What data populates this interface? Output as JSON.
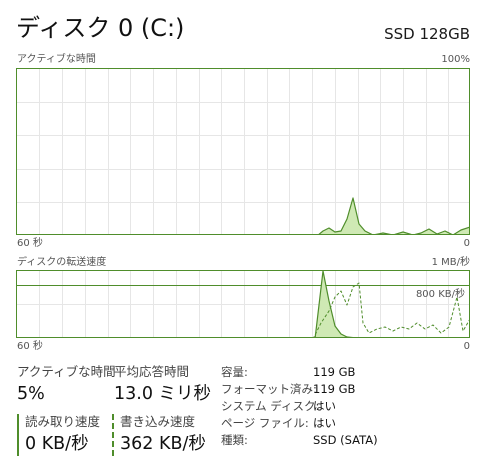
{
  "header": {
    "title": "ディスク 0 (C:)",
    "model": "SSD 128GB"
  },
  "active_time_graph": {
    "label": "アクティブな時間",
    "max_label": "100%",
    "time_label": "60 秒",
    "min_label": "0"
  },
  "transfer_graph": {
    "label": "ディスクの転送速度",
    "max_label": "1 MB/秒",
    "threshold_label": "800 KB/秒",
    "time_label": "60 秒",
    "min_label": "0"
  },
  "stats": {
    "active_time": {
      "label": "アクティブな時間",
      "value": "5%"
    },
    "response_time": {
      "label": "平均応答時間",
      "value": "13.0 ミリ秒"
    },
    "read_speed": {
      "label": "読み取り速度",
      "value": "0 KB/秒"
    },
    "write_speed": {
      "label": "書き込み速度",
      "value": "362 KB/秒"
    }
  },
  "details": [
    {
      "key": "容量:",
      "value": "119 GB"
    },
    {
      "key": "フォーマット済み:",
      "value": "119 GB"
    },
    {
      "key": "システム ディスク:",
      "value": "はい"
    },
    {
      "key": "ページ ファイル:",
      "value": "はい"
    },
    {
      "key": "種類:",
      "value": "SSD (SATA)"
    }
  ],
  "colors": {
    "accent": "#4f8d2b",
    "fill": "#cfe9b4",
    "grid": "#e4e4e4"
  }
}
